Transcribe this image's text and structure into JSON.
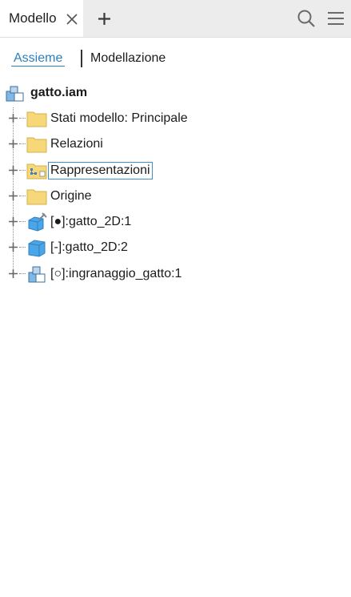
{
  "tab": {
    "label": "Modello"
  },
  "subtabs": {
    "assieme": "Assieme",
    "modellazione": "Modellazione"
  },
  "tree": {
    "root": {
      "label": "gatto.iam",
      "icon": "assembly-icon"
    },
    "items": [
      {
        "label": "Stati modello: Principale",
        "icon": "folder-icon"
      },
      {
        "label": "Relazioni",
        "icon": "folder-icon"
      },
      {
        "label": "Rappresentazioni",
        "icon": "representations-folder-icon",
        "selected": true
      },
      {
        "label": "Origine",
        "icon": "folder-icon"
      },
      {
        "label": "[●]:gatto_2D:1",
        "icon": "part-pinned-icon"
      },
      {
        "label": "[-]:gatto_2D:2",
        "icon": "part-icon"
      },
      {
        "label": "[○]:ingranaggio_gatto:1",
        "icon": "subassembly-icon"
      }
    ]
  },
  "colors": {
    "accent": "#2a7fc0",
    "folder": "#f6d77a",
    "part": "#4aa6e8"
  }
}
